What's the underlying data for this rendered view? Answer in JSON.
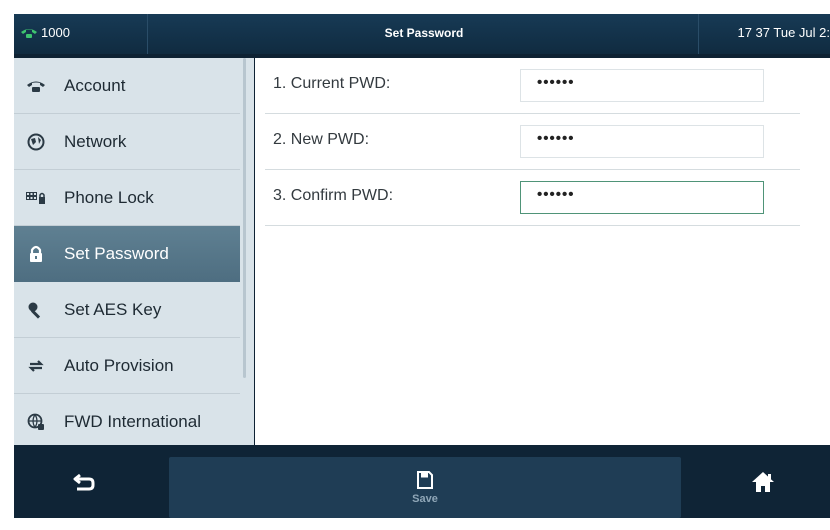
{
  "status_bar": {
    "line": "1000",
    "title": "Set Password",
    "clock": "17 37 Tue Jul 2:"
  },
  "sidebar": {
    "items": [
      {
        "label": "Account",
        "icon": "phone-icon",
        "active": false
      },
      {
        "label": "Network",
        "icon": "globe-icon",
        "active": false
      },
      {
        "label": "Phone Lock",
        "icon": "keypad-icon",
        "active": false
      },
      {
        "label": "Set Password",
        "icon": "lock-icon",
        "active": true
      },
      {
        "label": "Set AES Key",
        "icon": "key-icon",
        "active": false
      },
      {
        "label": "Auto Provision",
        "icon": "sync-icon",
        "active": false
      },
      {
        "label": "FWD International",
        "icon": "globe-phone-icon",
        "active": false
      }
    ]
  },
  "form": {
    "rows": [
      {
        "label": "1. Current PWD:",
        "value": "••••••"
      },
      {
        "label": "2. New PWD:",
        "value": "••••••"
      },
      {
        "label": "3. Confirm PWD:",
        "value": "••••••",
        "focused": true
      }
    ]
  },
  "bottom_bar": {
    "back_icon": "back-arrow-icon",
    "save_label": "Save",
    "save_icon": "floppy-disk-icon",
    "home_icon": "home-icon"
  },
  "colors": {
    "status_bar": "#173a55",
    "sidebar_bg": "#d9e3e9",
    "active_item": "#567788",
    "focus_border": "#4f9478",
    "bottom_bar": "#0f2436",
    "accent_green": "#3ec46f"
  }
}
